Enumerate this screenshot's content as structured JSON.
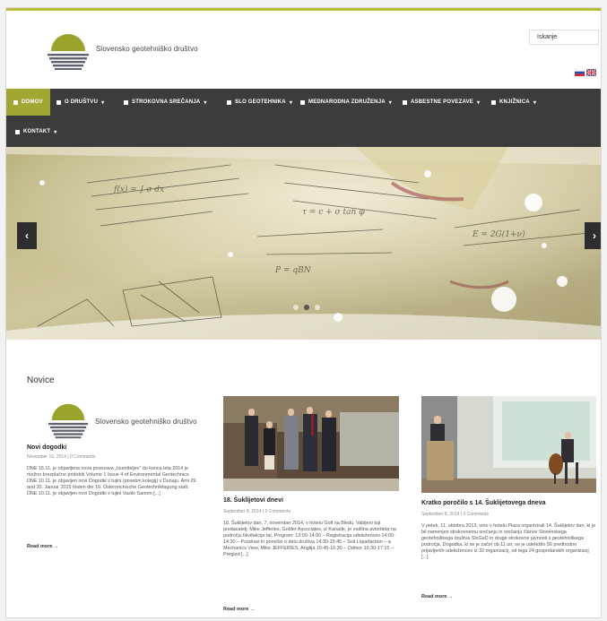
{
  "header": {
    "brand": "Slovensko geotehniško društvo",
    "search_placeholder": "Iskanje",
    "languages": [
      "Slovenščina",
      "English"
    ]
  },
  "nav": {
    "items": [
      {
        "label": "DOMOV",
        "icon": "home-icon",
        "active": true
      },
      {
        "label": "O DRUŠTVU",
        "icon": "folder-icon"
      },
      {
        "label": "STROKOVNA SREČANJA",
        "icon": "calendar-icon"
      },
      {
        "label": "SLO GEOTEHNIKA",
        "icon": "book-icon"
      },
      {
        "label": "MEDNARODNA ZDRUŽENJA",
        "icon": "globe-icon"
      },
      {
        "label": "ASBESTNE POVEZAVE",
        "icon": "link-icon"
      },
      {
        "label": "KNJIŽNICA",
        "icon": "library-icon"
      },
      {
        "label": "KONTAKT",
        "icon": "mail-icon"
      }
    ]
  },
  "slider": {
    "prev": "‹",
    "next": "›"
  },
  "news": {
    "title": "Novice",
    "posts": [
      {
        "title": "Novi dogodki",
        "meta": "November 16, 2014 | 0 Comments",
        "body": "DNE 15.11. je objavljena nova povezava „Izumiteljev“ do konca leta 2014 je možno brezplačno pridobiti Volume 1 Issue 4 of Environmental Geotechnics DNE 10.11. je objavljen novi Dogodki v tujini (posebni kolegij) v Dunaju. Ami 29. and 30. Januar 2015 finden die 10. Österreichische Geotechniktagung statt. DNE 10.11. je objavljen novi Dogodki v tujini Vasilo Sanom [...]",
        "read_more": "Read more →"
      },
      {
        "title": "18. Šuklijetovi dnevi",
        "meta": "September 8, 2014 | 0 Comments",
        "body": "18. Šuklijetov dan, 7. november 2014, v hotelu Golf na Bledu. Vabljeni tuji predavatelj: Mike Jefferies, Golder Associates, iz Kanade, je vodilna avtoriteta na področju likvifakcije tal. Program: 13:00-14:00 – Registracija udeležencev 14:00-14:30 – Pozdravi in poročilo o delu društva 14:30-15:45 – Soil Liquefaction – a Mechanics View, Mike JEFFERIES, Anglija 15:45-16:30 – Odmor 16:30-17:15 – Pregled [...]",
        "read_more": "Read more →"
      },
      {
        "title": "Kratko poročilo s 14. Šuklijetovega dneva",
        "meta": "September 8, 2014 | 0 Comments",
        "body": "V petek, 11. oktobra 2013, smo v hotelu Plaza organizirali 14. Šuklijetov dan, ki je bil namenjen strokovnemu srečanju in srečanju članov Slovenskega geotehniškega društva SloGeD in druge strokovne javnosti s geotehniškega področja. Dogodka, ki se je začel ob 11 uri, se je udeležilo 56 predhodno prijavljenih udeležencev iz 32 organizacij, od tega 24 gospodarskih organizacij [...]",
        "read_more": "Read more →"
      }
    ]
  },
  "colors": {
    "accent": "#a1a733",
    "nav_bg": "#3c3c3c",
    "logo_green": "#9aa32b",
    "logo_gray": "#5e6370"
  }
}
